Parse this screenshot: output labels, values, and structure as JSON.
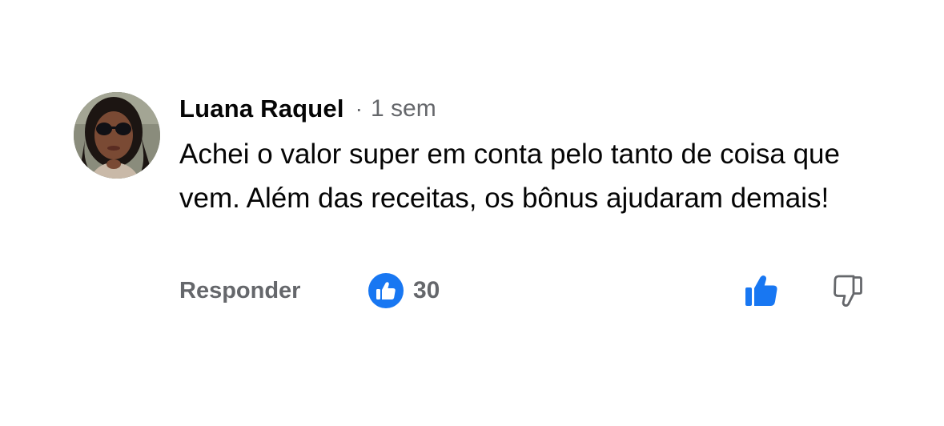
{
  "comment": {
    "author": "Luana Raquel",
    "separator": "·",
    "time": "1 sem",
    "text": "Achei o valor super em conta pelo tanto de coisa que vem. Além das receitas, os bônus ajudaram demais!",
    "reply_label": "Responder",
    "reaction_count": "30",
    "reaction_icon": "like-icon",
    "upvote_icon": "thumbs-up-icon",
    "downvote_icon": "thumbs-down-icon"
  },
  "colors": {
    "accent": "#1877f2",
    "text_primary": "#050505",
    "text_secondary": "#65676b",
    "background": "#ffffff"
  }
}
